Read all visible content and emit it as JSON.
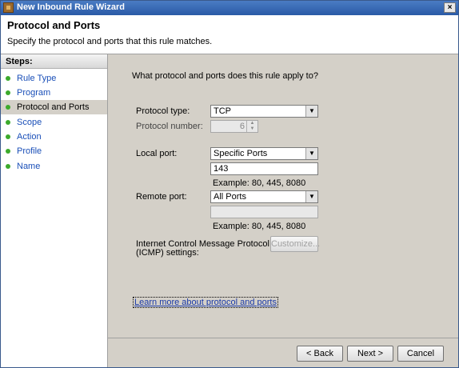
{
  "window": {
    "title": "New Inbound Rule Wizard",
    "close_label": "×"
  },
  "header": {
    "title": "Protocol and Ports",
    "subtitle": "Specify the protocol and ports that this rule matches."
  },
  "sidebar": {
    "title": "Steps:",
    "items": [
      {
        "label": "Rule Type"
      },
      {
        "label": "Program"
      },
      {
        "label": "Protocol and Ports",
        "active": true
      },
      {
        "label": "Scope"
      },
      {
        "label": "Action"
      },
      {
        "label": "Profile"
      },
      {
        "label": "Name"
      }
    ]
  },
  "main": {
    "question": "What protocol and ports does this rule apply to?",
    "protocol_type": {
      "label": "Protocol type:",
      "value": "TCP"
    },
    "protocol_number": {
      "label": "Protocol number:",
      "value": "6"
    },
    "local_port": {
      "label": "Local port:",
      "value": "Specific Ports",
      "input": "143",
      "example": "Example: 80, 445, 8080"
    },
    "remote_port": {
      "label": "Remote port:",
      "value": "All Ports",
      "input": "",
      "example": "Example: 80, 445, 8080"
    },
    "icmp": {
      "label_line1": "Internet Control Message Protocol",
      "label_line2": "(ICMP) settings:",
      "button": "Customize..."
    },
    "learn_more": "Learn more about protocol and ports"
  },
  "footer": {
    "back": "< Back",
    "next": "Next >",
    "cancel": "Cancel"
  },
  "icons": {
    "dropdown": "▼",
    "spin_up": "▲",
    "spin_down": "▼"
  }
}
